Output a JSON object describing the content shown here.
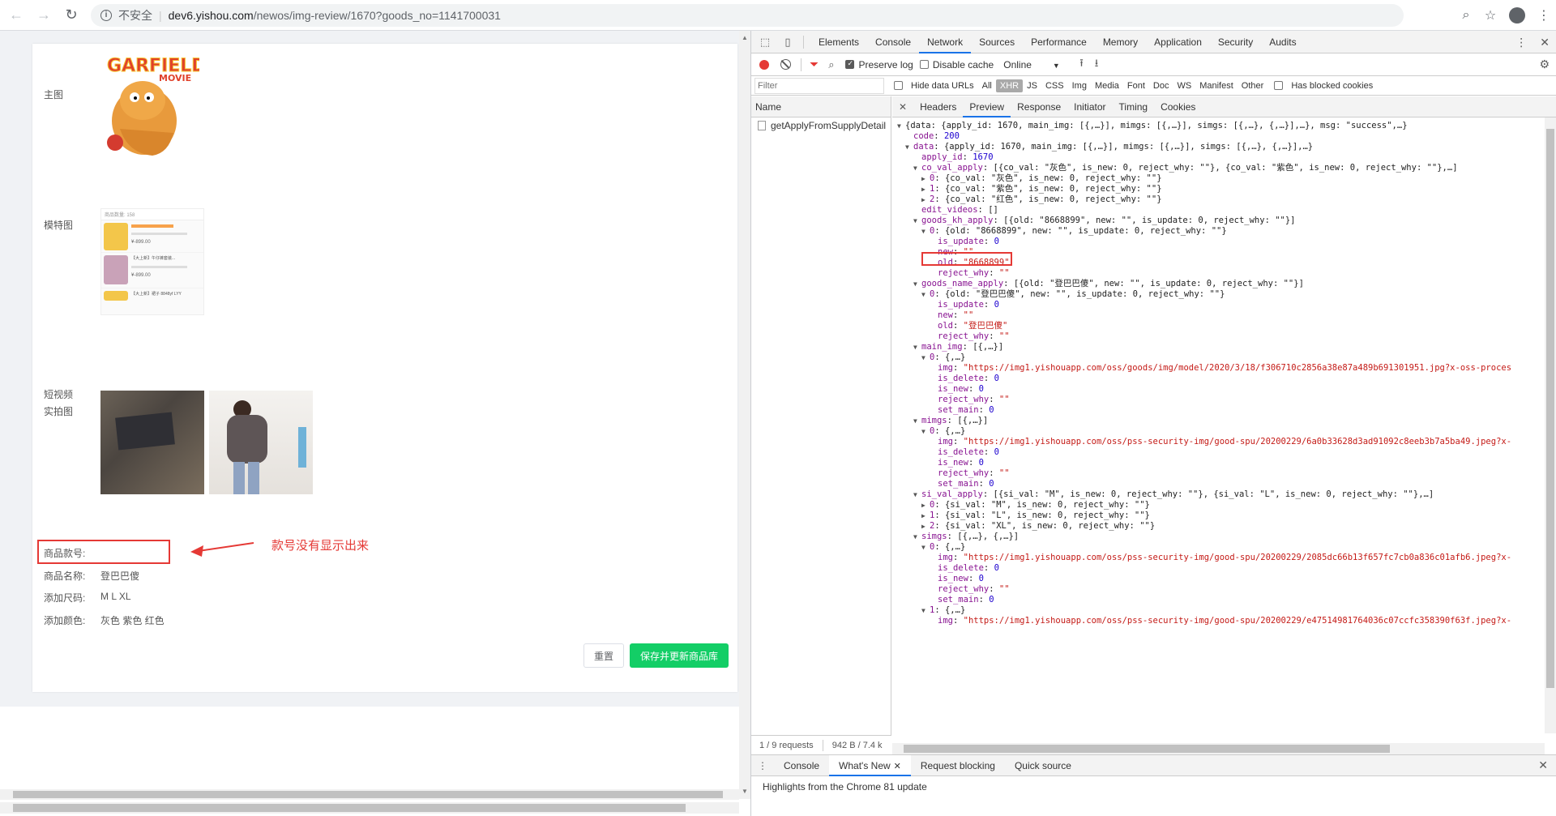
{
  "browser": {
    "insecure_label": "不安全",
    "url_host": "dev6.yishou.com",
    "url_path": "/newos/img-review/1670?goods_no=1141700031"
  },
  "page": {
    "labels": {
      "main_img": "主图",
      "model_img": "模特图",
      "short_video": "短视频",
      "real_img": "实拍图",
      "goods_kh": "商品款号:",
      "goods_name": "商品名称:",
      "add_size": "添加尺码:",
      "add_color": "添加颜色:"
    },
    "values": {
      "goods_name": "登巴巴傻",
      "add_size": "M L XL",
      "add_color": "灰色 紫色 红色"
    },
    "main_img_text": "GARFIELD",
    "main_img_sub": "MOVIE",
    "model_card": {
      "header": "商品数量: 158",
      "row1_price": "¥-899.00",
      "row2_title": "【大上新】午仔裤套装...",
      "row2_price": "¥-899.00",
      "row3_title": "【大上新】裙子 8848yf LYY"
    },
    "annotation": "款号没有显示出来",
    "btn_reset": "重置",
    "btn_save": "保存并更新商品库"
  },
  "devtools": {
    "tabs": [
      "Elements",
      "Console",
      "Network",
      "Sources",
      "Performance",
      "Memory",
      "Application",
      "Security",
      "Audits"
    ],
    "active_tab": "Network",
    "toolbar": {
      "preserve_log": "Preserve log",
      "disable_cache": "Disable cache",
      "throttle": "Online"
    },
    "filter": {
      "placeholder": "Filter",
      "hide_data_urls": "Hide data URLs",
      "types": [
        "All",
        "XHR",
        "JS",
        "CSS",
        "Img",
        "Media",
        "Font",
        "Doc",
        "WS",
        "Manifest",
        "Other"
      ],
      "active_type": "XHR",
      "has_blocked": "Has blocked cookies"
    },
    "name_header": "Name",
    "request_name": "getApplyFromSupplyDetail",
    "status_requests": "1 / 9 requests",
    "status_size": "942 B / 7.4 k",
    "detail_tabs": [
      "Headers",
      "Preview",
      "Response",
      "Initiator",
      "Timing",
      "Cookies"
    ],
    "active_detail_tab": "Preview",
    "drawer_tabs": [
      "Console",
      "What's New",
      "Request blocking",
      "Quick source"
    ],
    "drawer_active": "What's New",
    "drawer_message": "Highlights from the Chrome 81 update"
  },
  "json_lines": [
    {
      "i": 0,
      "t": "▼",
      "k": "",
      "v": "{data: {apply_id: 1670, main_img: [{,…}], mimgs: [{,…}], simgs: [{,…}, {,…}],…}, msg: \"success\",…}",
      "c": "plain"
    },
    {
      "i": 1,
      "t": "",
      "k": "code",
      "v": "200",
      "c": "n"
    },
    {
      "i": 1,
      "t": "▼",
      "k": "data",
      "v": "{apply_id: 1670, main_img: [{,…}], mimgs: [{,…}], simgs: [{,…}, {,…}],…}",
      "c": "plain"
    },
    {
      "i": 2,
      "t": "",
      "k": "apply_id",
      "v": "1670",
      "c": "n"
    },
    {
      "i": 2,
      "t": "▼",
      "k": "co_val_apply",
      "v": "[{co_val: \"灰色\", is_new: 0, reject_why: \"\"}, {co_val: \"紫色\", is_new: 0, reject_why: \"\"},…]",
      "c": "plain"
    },
    {
      "i": 3,
      "t": "▶",
      "k": "0",
      "v": "{co_val: \"灰色\", is_new: 0, reject_why: \"\"}",
      "c": "plain"
    },
    {
      "i": 3,
      "t": "▶",
      "k": "1",
      "v": "{co_val: \"紫色\", is_new: 0, reject_why: \"\"}",
      "c": "plain"
    },
    {
      "i": 3,
      "t": "▶",
      "k": "2",
      "v": "{co_val: \"红色\", is_new: 0, reject_why: \"\"}",
      "c": "plain"
    },
    {
      "i": 2,
      "t": "",
      "k": "edit_videos",
      "v": "[]",
      "c": "plain"
    },
    {
      "i": 2,
      "t": "▼",
      "k": "goods_kh_apply",
      "v": "[{old: \"8668899\", new: \"\", is_update: 0, reject_why: \"\"}]",
      "c": "plain"
    },
    {
      "i": 3,
      "t": "▼",
      "k": "0",
      "v": "{old: \"8668899\", new: \"\", is_update: 0, reject_why: \"\"}",
      "c": "plain"
    },
    {
      "i": 4,
      "t": "",
      "k": "is_update",
      "v": "0",
      "c": "n"
    },
    {
      "i": 4,
      "t": "",
      "k": "new",
      "v": "\"\"",
      "c": "s"
    },
    {
      "i": 4,
      "t": "",
      "k": "old",
      "v": "\"8668899\"",
      "c": "s"
    },
    {
      "i": 4,
      "t": "",
      "k": "reject_why",
      "v": "\"\"",
      "c": "s"
    },
    {
      "i": 2,
      "t": "▼",
      "k": "goods_name_apply",
      "v": "[{old: \"登巴巴傻\", new: \"\", is_update: 0, reject_why: \"\"}]",
      "c": "plain"
    },
    {
      "i": 3,
      "t": "▼",
      "k": "0",
      "v": "{old: \"登巴巴傻\", new: \"\", is_update: 0, reject_why: \"\"}",
      "c": "plain"
    },
    {
      "i": 4,
      "t": "",
      "k": "is_update",
      "v": "0",
      "c": "n"
    },
    {
      "i": 4,
      "t": "",
      "k": "new",
      "v": "\"\"",
      "c": "s"
    },
    {
      "i": 4,
      "t": "",
      "k": "old",
      "v": "\"登巴巴傻\"",
      "c": "s"
    },
    {
      "i": 4,
      "t": "",
      "k": "reject_why",
      "v": "\"\"",
      "c": "s"
    },
    {
      "i": 2,
      "t": "▼",
      "k": "main_img",
      "v": "[{,…}]",
      "c": "plain"
    },
    {
      "i": 3,
      "t": "▼",
      "k": "0",
      "v": "{,…}",
      "c": "plain"
    },
    {
      "i": 4,
      "t": "",
      "k": "img",
      "v": "\"https://img1.yishouapp.com/oss/goods/img/model/2020/3/18/f306710c2856a38e87a489b691301951.jpg?x-oss-proces",
      "c": "s"
    },
    {
      "i": 4,
      "t": "",
      "k": "is_delete",
      "v": "0",
      "c": "n"
    },
    {
      "i": 4,
      "t": "",
      "k": "is_new",
      "v": "0",
      "c": "n"
    },
    {
      "i": 4,
      "t": "",
      "k": "reject_why",
      "v": "\"\"",
      "c": "s"
    },
    {
      "i": 4,
      "t": "",
      "k": "set_main",
      "v": "0",
      "c": "n"
    },
    {
      "i": 2,
      "t": "▼",
      "k": "mimgs",
      "v": "[{,…}]",
      "c": "plain"
    },
    {
      "i": 3,
      "t": "▼",
      "k": "0",
      "v": "{,…}",
      "c": "plain"
    },
    {
      "i": 4,
      "t": "",
      "k": "img",
      "v": "\"https://img1.yishouapp.com/oss/pss-security-img/good-spu/20200229/6a0b33628d3ad91092c8eeb3b7a5ba49.jpeg?x-",
      "c": "s"
    },
    {
      "i": 4,
      "t": "",
      "k": "is_delete",
      "v": "0",
      "c": "n"
    },
    {
      "i": 4,
      "t": "",
      "k": "is_new",
      "v": "0",
      "c": "n"
    },
    {
      "i": 4,
      "t": "",
      "k": "reject_why",
      "v": "\"\"",
      "c": "s"
    },
    {
      "i": 4,
      "t": "",
      "k": "set_main",
      "v": "0",
      "c": "n"
    },
    {
      "i": 2,
      "t": "▼",
      "k": "si_val_apply",
      "v": "[{si_val: \"M\", is_new: 0, reject_why: \"\"}, {si_val: \"L\", is_new: 0, reject_why: \"\"},…]",
      "c": "plain"
    },
    {
      "i": 3,
      "t": "▶",
      "k": "0",
      "v": "{si_val: \"M\", is_new: 0, reject_why: \"\"}",
      "c": "plain"
    },
    {
      "i": 3,
      "t": "▶",
      "k": "1",
      "v": "{si_val: \"L\", is_new: 0, reject_why: \"\"}",
      "c": "plain"
    },
    {
      "i": 3,
      "t": "▶",
      "k": "2",
      "v": "{si_val: \"XL\", is_new: 0, reject_why: \"\"}",
      "c": "plain"
    },
    {
      "i": 2,
      "t": "▼",
      "k": "simgs",
      "v": "[{,…}, {,…}]",
      "c": "plain"
    },
    {
      "i": 3,
      "t": "▼",
      "k": "0",
      "v": "{,…}",
      "c": "plain"
    },
    {
      "i": 4,
      "t": "",
      "k": "img",
      "v": "\"https://img1.yishouapp.com/oss/pss-security-img/good-spu/20200229/2085dc66b13f657fc7cb0a836c01afb6.jpeg?x-",
      "c": "s"
    },
    {
      "i": 4,
      "t": "",
      "k": "is_delete",
      "v": "0",
      "c": "n"
    },
    {
      "i": 4,
      "t": "",
      "k": "is_new",
      "v": "0",
      "c": "n"
    },
    {
      "i": 4,
      "t": "",
      "k": "reject_why",
      "v": "\"\"",
      "c": "s"
    },
    {
      "i": 4,
      "t": "",
      "k": "set_main",
      "v": "0",
      "c": "n"
    },
    {
      "i": 3,
      "t": "▼",
      "k": "1",
      "v": "{,…}",
      "c": "plain"
    },
    {
      "i": 4,
      "t": "",
      "k": "img",
      "v": "\"https://img1.yishouapp.com/oss/pss-security-img/good-spu/20200229/e47514981764036c07ccfc358390f63f.jpeg?x-",
      "c": "s"
    }
  ]
}
